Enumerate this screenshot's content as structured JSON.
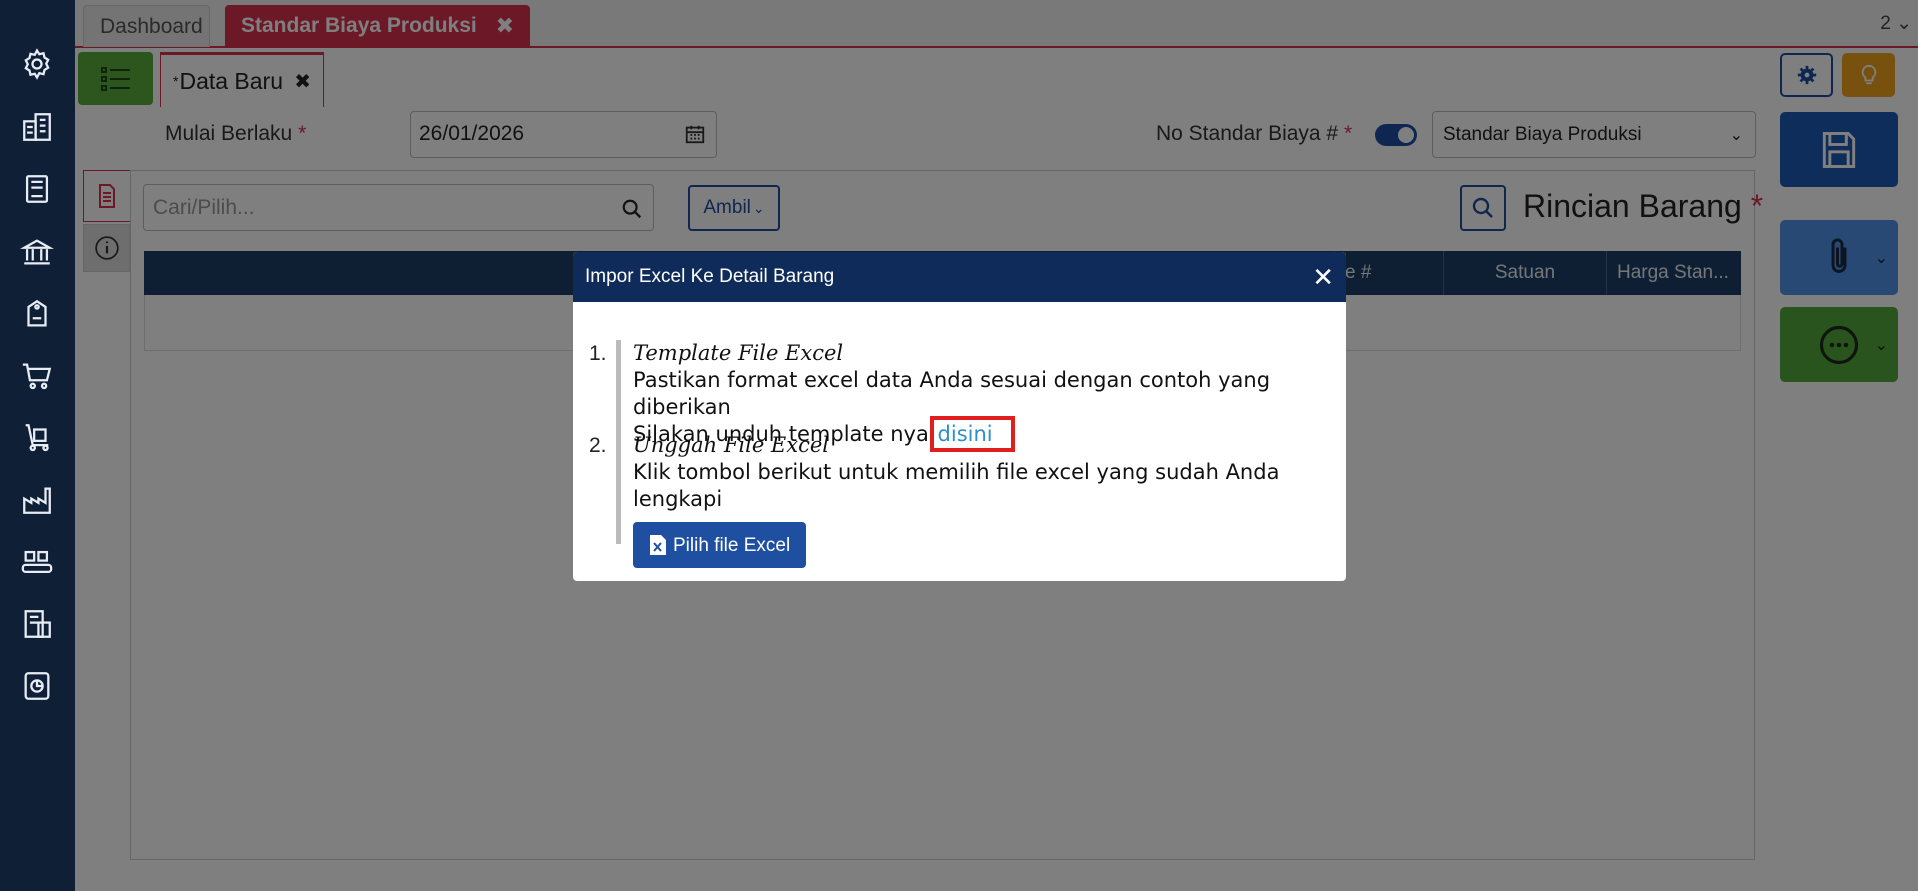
{
  "top_tabs": {
    "dashboard": "Dashboard",
    "active": "Standar Biaya Produksi",
    "close_glyph": "✖",
    "right_indicator": "2 ⌄"
  },
  "sub_tab": {
    "label": "Data Baru",
    "dirty_marker": "*",
    "close_glyph": "✖"
  },
  "form": {
    "mulai_label": "Mulai Berlaku",
    "mulai_value": "26/01/2026",
    "no_standar_label": "No Standar Biaya #",
    "required_marker": "*",
    "select_value": "Standar Biaya Produksi"
  },
  "detail": {
    "search_placeholder": "Cari/Pilih...",
    "ambil_label": "Ambil",
    "section_title": "Rincian Barang",
    "columns": [
      "e #",
      "Satuan",
      "Harga Stan..."
    ]
  },
  "modal": {
    "title": "Impor Excel Ke Detail Barang",
    "close_glyph": "✕",
    "steps": [
      {
        "num": "1.",
        "title": "Template File Excel",
        "line1": "Pastikan format excel data Anda sesuai dengan contoh yang diberikan",
        "line2": "Silakan unduh template nya",
        "link": "disini"
      },
      {
        "num": "2.",
        "title": "Unggah File Excel",
        "line1": "Klik tombol berikut untuk memilih file excel yang sudah Anda lengkapi",
        "button": "Pilih file Excel"
      }
    ]
  },
  "colors": {
    "sidebar": "#0f1f36",
    "accent_red": "#d9304f",
    "primary_blue": "#1e4fa0",
    "modal_header": "#0f2b5a",
    "link": "#2d8fd0",
    "highlight": "#e01e1e"
  },
  "icons": {
    "sidebar": [
      "gear-icon",
      "building-icon",
      "book-icon",
      "bank-icon",
      "price-tag-icon",
      "cart-icon",
      "hand-truck-icon",
      "factory-icon",
      "conveyor-icon",
      "tax-icon",
      "report-icon"
    ]
  }
}
